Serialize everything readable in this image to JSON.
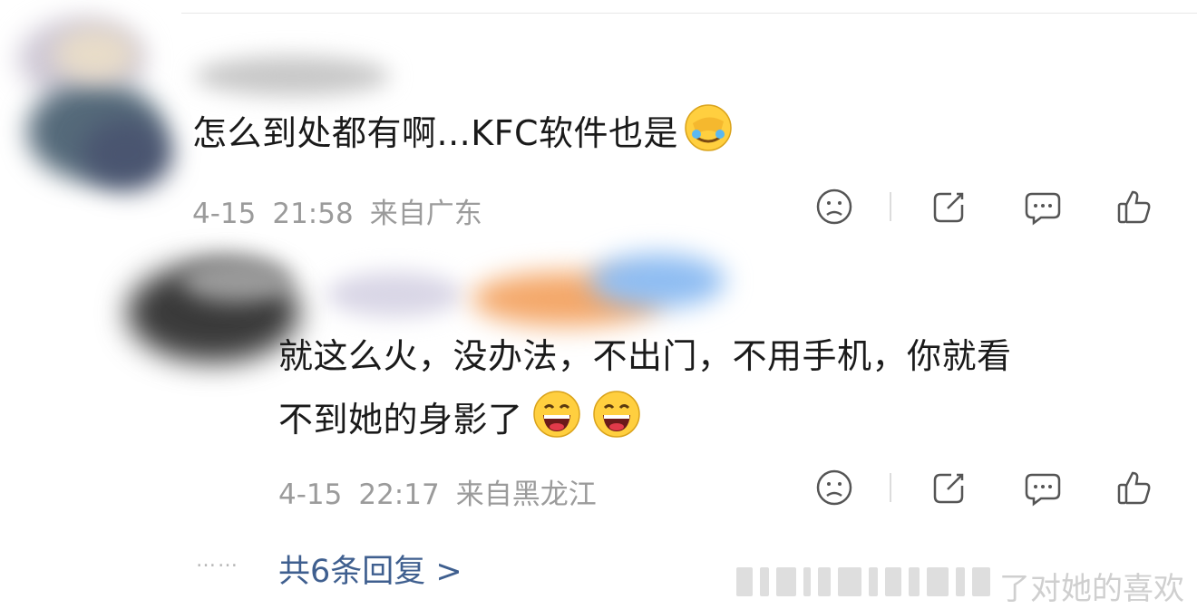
{
  "comments": [
    {
      "text": "怎么到处都有啊...KFC软件也是",
      "emoji": [
        "facepalm-laugh-emoji"
      ],
      "date": "4-15",
      "time": "21:58",
      "location": "来自广东"
    },
    {
      "text_line1": "就这么火，没办法，不出门，不用手机，你就看",
      "text_line2": "不到她的身影了",
      "emoji": [
        "grin-emoji",
        "grin-emoji"
      ],
      "date": "4-15",
      "time": "22:17",
      "location": "来自黑龙江"
    }
  ],
  "actions": [
    "dislike-icon",
    "share-icon",
    "comment-icon",
    "like-icon"
  ],
  "replies": {
    "dots": "……",
    "label": "共6条回复 >"
  },
  "watermark": {
    "text": "了对她的喜欢"
  },
  "colors": {
    "text": "#1a1a1a",
    "meta": "#9b9b9b",
    "link": "#3f5f8f",
    "icon": "#555555"
  }
}
